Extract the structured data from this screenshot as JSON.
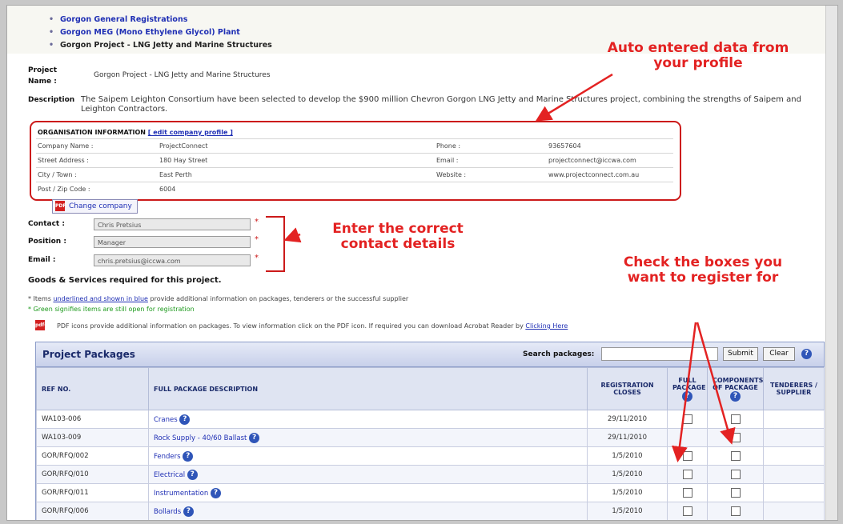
{
  "registrations": [
    {
      "label": "Gorgon General Registrations"
    },
    {
      "label": "Gorgon MEG (Mono Ethylene Glycol) Plant"
    },
    {
      "label": "Gorgon Project - LNG Jetty and Marine Structures"
    }
  ],
  "project": {
    "name_label": "Project Name :",
    "name_value": "Gorgon Project - LNG Jetty and Marine Structures",
    "description_label": "Description",
    "description_value": "The Saipem Leighton Consortium have been selected to develop the $900 million Chevron Gorgon LNG Jetty and Marine Structures project, combining the strengths of Saipem and Leighton Contractors."
  },
  "organization": {
    "title": "ORGANISATION INFORMATION",
    "edit_link": "[ edit company profile ]",
    "rows": [
      {
        "l1": "Company Name :",
        "v1": "ProjectConnect",
        "l2": "Phone :",
        "v2": "93657604"
      },
      {
        "l1": "Street Address :",
        "v1": "180 Hay Street",
        "l2": "Email :",
        "v2": "projectconnect@iccwa.com"
      },
      {
        "l1": "City / Town :",
        "v1": "East Perth",
        "l2": "Website :",
        "v2": "www.projectconnect.com.au"
      },
      {
        "l1": "Post / Zip Code :",
        "v1": "6004",
        "l2": "",
        "v2": ""
      }
    ]
  },
  "change_company": "Change company",
  "contact": {
    "contact_label": "Contact :",
    "contact_value": "Chris Pretsius",
    "position_label": "Position :",
    "position_value": "Manager",
    "email_label": "Email :",
    "email_value": "chris.pretsius@iccwa.com",
    "required_mark": "*"
  },
  "goods_heading": "Goods & Services required for this project.",
  "notes": {
    "items_prefix": "* Items ",
    "items_link": "underlined and shown in blue",
    "items_suffix": " provide additional information on packages, tenderers or the successful supplier",
    "green": "* Green signifies items are still open for registration",
    "pdf": "PDF icons provide additional information on packages. To view information click on the PDF icon.  If required you can download Acrobat Reader by ",
    "pdf_link": "Clicking Here",
    "pdf_icon": "pdf-icon"
  },
  "annotations": {
    "auto": "Auto entered data from your profile",
    "contact": "Enter the correct contact details",
    "check": "Check the boxes you want to register for"
  },
  "packages": {
    "title": "Project Packages",
    "search_label": "Search packages:",
    "search_value": "",
    "submit_label": "Submit",
    "clear_label": "Clear",
    "help_glyph": "?",
    "columns": {
      "ref": "REF NO.",
      "desc": "FULL PACKAGE DESCRIPTION",
      "closes": "REGISTRATION CLOSES",
      "full": "FULL PACKAGE",
      "components": "COMPONENTS OF PACKAGE",
      "tenderers": "TENDERERS / SUPPLIER"
    },
    "rows": [
      {
        "ref": "WA103-006",
        "desc": "Cranes",
        "closes": "29/11/2010",
        "status": "closed"
      },
      {
        "ref": "WA103-009",
        "desc": "Rock Supply - 40/60 Ballast",
        "closes": "29/11/2010",
        "status": "closed"
      },
      {
        "ref": "GOR/RFQ/002",
        "desc": "Fenders",
        "closes": "1/5/2010",
        "status": "open"
      },
      {
        "ref": "GOR/RFQ/010",
        "desc": "Electrical",
        "closes": "1/5/2010",
        "status": "open"
      },
      {
        "ref": "GOR/RFQ/011",
        "desc": "Instrumentation",
        "closes": "1/5/2010",
        "status": "open"
      },
      {
        "ref": "GOR/RFQ/006",
        "desc": "Bollards",
        "closes": "1/5/2010",
        "status": "open"
      }
    ]
  }
}
